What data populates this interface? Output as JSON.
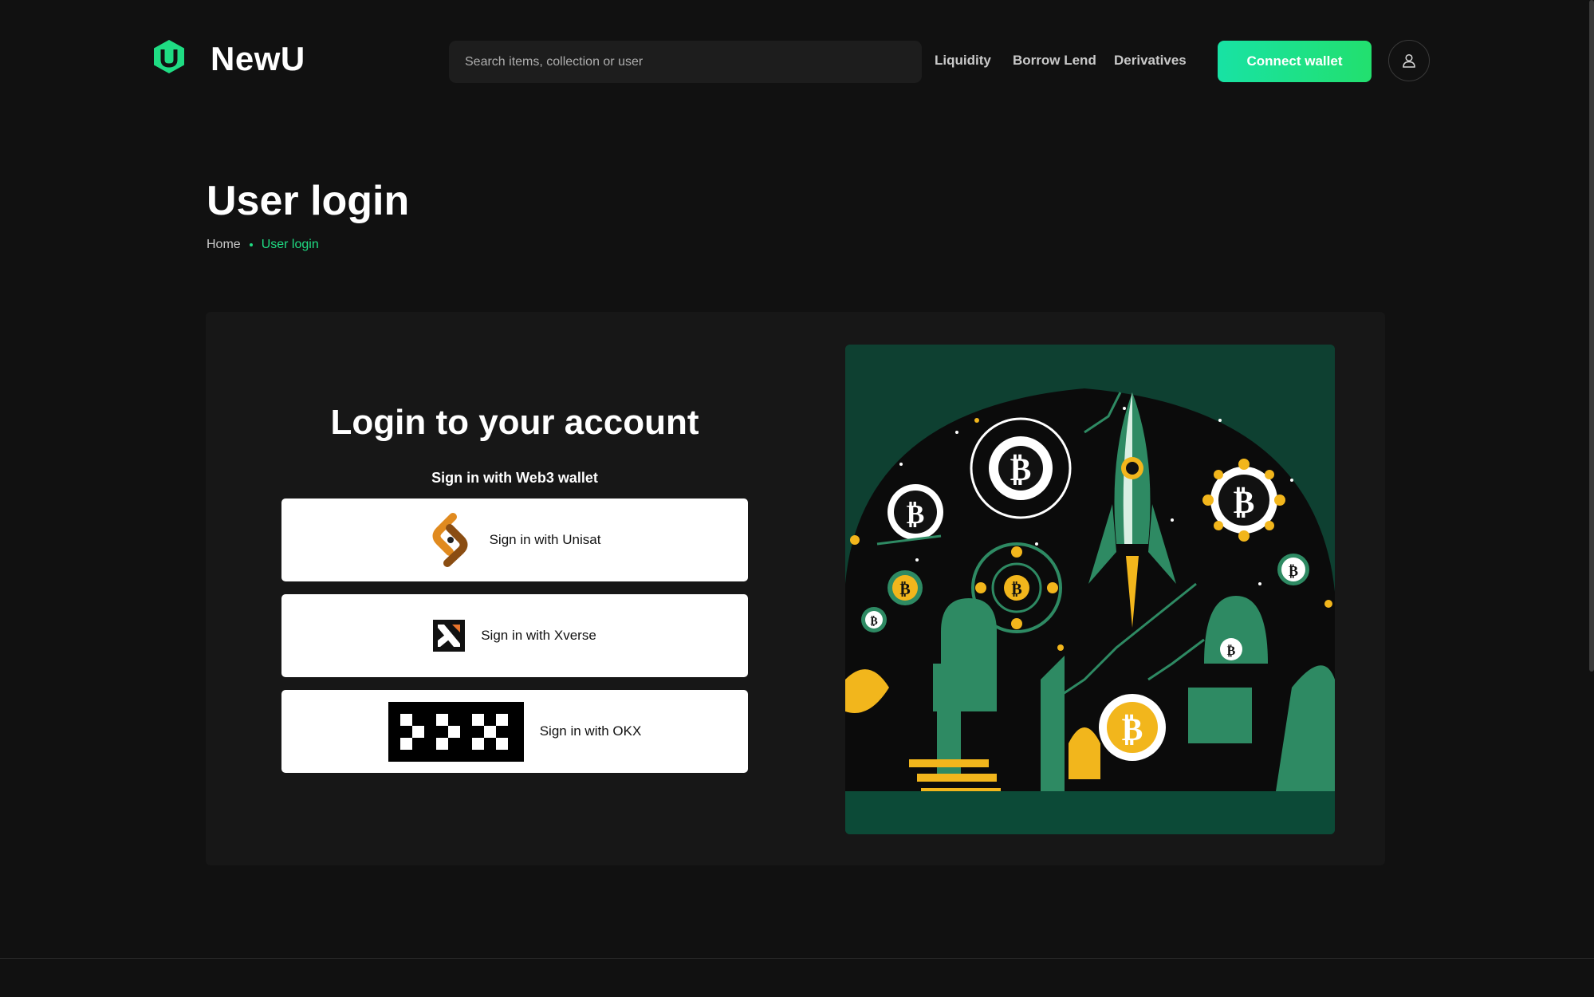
{
  "brand": {
    "name": "NewU",
    "accent": "#1fdc83",
    "gradient_from": "#18e2a4",
    "gradient_to": "#22e06e"
  },
  "header": {
    "search_placeholder": "Search items, collection or user",
    "nav": [
      "Liquidity",
      "Borrow Lend",
      "Derivatives"
    ],
    "connect_label": "Connect wallet",
    "user_icon": "user-icon"
  },
  "page": {
    "title": "User login",
    "breadcrumb": {
      "home": "Home",
      "current": "User login"
    }
  },
  "login": {
    "title": "Login to your account",
    "subtitle": "Sign in with Web3 wallet",
    "buttons": [
      {
        "label": "Sign in with Unisat",
        "icon": "unisat-icon"
      },
      {
        "label": "Sign in with Xverse",
        "icon": "xverse-icon"
      },
      {
        "label": "Sign in with OKX",
        "icon": "okx-icon"
      }
    ]
  },
  "illustration": {
    "icon": "bitcoin-rocket-illustration"
  }
}
